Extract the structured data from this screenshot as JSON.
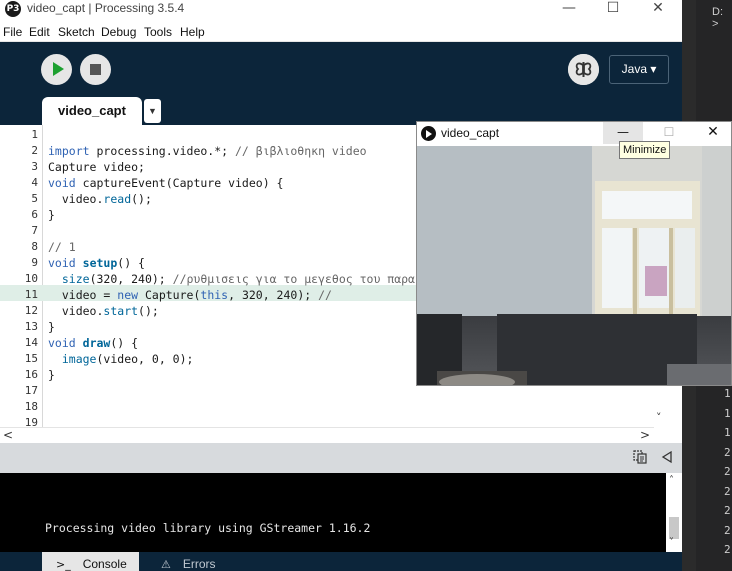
{
  "window": {
    "title": "video_capt | Processing 3.5.4",
    "logo_glyph": "P3",
    "minimize_glyph": "—",
    "maximize_glyph": "☐",
    "close_glyph": "✕"
  },
  "menu": [
    "File",
    "Edit",
    "Sketch",
    "Debug",
    "Tools",
    "Help"
  ],
  "toolbar": {
    "run_icon": "play-icon",
    "stop_icon": "stop-icon",
    "debug_icon": "butterfly-icon",
    "mode_label": "Java ▾"
  },
  "tab": {
    "name": "video_capt",
    "menu_arrow": "▼"
  },
  "editor": {
    "line_numbers": [
      "1",
      "2",
      "3",
      "4",
      "5",
      "6",
      "7",
      "8",
      "9",
      "10",
      "11",
      "12",
      "13",
      "14",
      "15",
      "16",
      "17",
      "18",
      "19"
    ],
    "highlighted_line": "11",
    "lines": [
      "",
      "import processing.video.*; // βιβλιοθηκη video",
      "Capture video;",
      "void captureEvent(Capture video) {",
      "  video.read();",
      "}",
      "",
      "// 1",
      "void setup() {",
      "  size(320, 240); //ρυθμισεις για το μεγεθος του παρα",
      "  video = new Capture(this, 320, 240); //",
      "  video.start();",
      "}",
      "void draw() {",
      "  image(video, 0, 0);",
      "}",
      "",
      "",
      ""
    ]
  },
  "scroll": {
    "left": "<",
    "right": ">",
    "down": "˅",
    "up": "˄"
  },
  "console": {
    "output": "Processing video library using GStreamer 1.16.2",
    "tabs": [
      {
        "label": "Console",
        "icon": "console-icon",
        "glyph": ">_",
        "active": true
      },
      {
        "label": "Errors",
        "icon": "warning-icon",
        "glyph": "⚠",
        "active": false
      }
    ],
    "copy_icon": "copy-icon",
    "collapse_icon": "collapse-icon"
  },
  "sketch_window": {
    "title": "video_capt",
    "tooltip": "Minimize",
    "minimize_glyph": "—",
    "maximize_glyph": "☐",
    "close_glyph": "✕"
  },
  "background_editor": {
    "drive_label": "D: >",
    "line_numbers": [
      "1",
      "1",
      "1",
      "2",
      "2",
      "2",
      "2",
      "2",
      "2"
    ]
  },
  "colors": {
    "toolbar_bg": "#0c253a",
    "run_green": "#1da030",
    "line_highlight": "#dfeee7",
    "keyword_blue": "#2f62b3",
    "function_teal": "#006699"
  }
}
